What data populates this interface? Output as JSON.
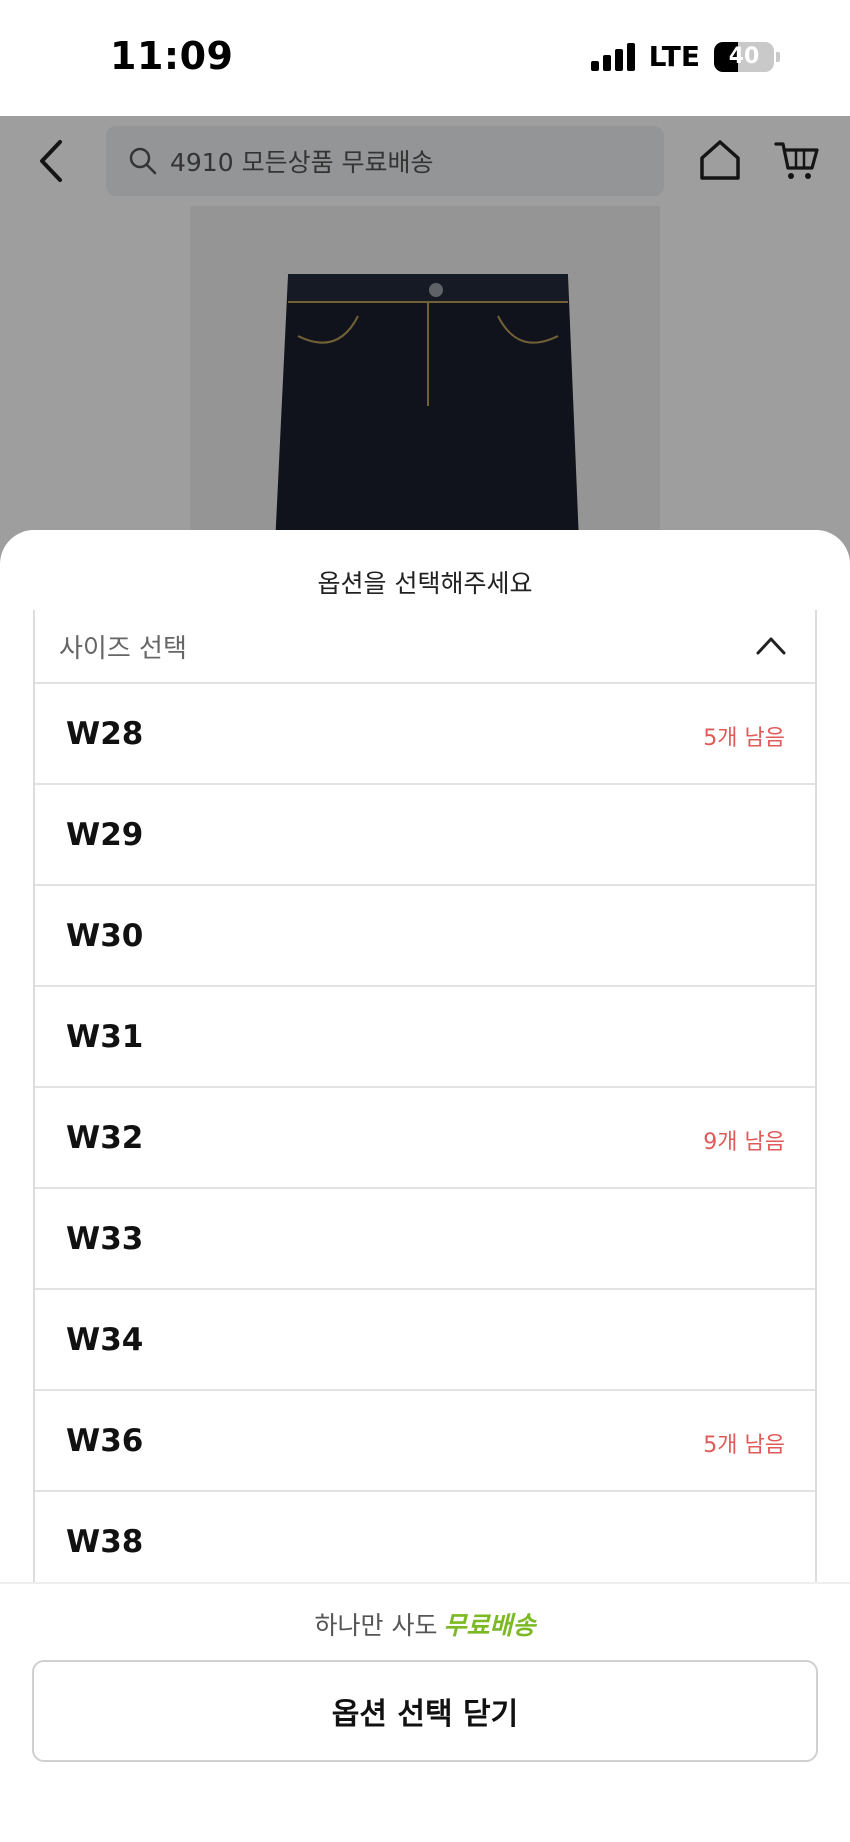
{
  "status_bar": {
    "time": "11:09",
    "network": "LTE",
    "battery": "40",
    "battery_level": 0.4
  },
  "header": {
    "search_text": "4910 모든상품 무료배송"
  },
  "sheet": {
    "title": "옵션을 선택해주세요",
    "dropdown_placeholder": "사이즈 선택",
    "options": [
      {
        "label": "W28",
        "stock": "5개 남음"
      },
      {
        "label": "W29",
        "stock": ""
      },
      {
        "label": "W30",
        "stock": ""
      },
      {
        "label": "W31",
        "stock": ""
      },
      {
        "label": "W32",
        "stock": "9개 남음"
      },
      {
        "label": "W33",
        "stock": ""
      },
      {
        "label": "W34",
        "stock": ""
      },
      {
        "label": "W36",
        "stock": "5개 남음"
      },
      {
        "label": "W38",
        "stock": ""
      }
    ],
    "promo_text": "하나만 사도",
    "promo_highlight": "무료배송",
    "close_button": "옵션 선택 닫기"
  },
  "colors": {
    "stock_text": "#e05a5a",
    "promo_highlight": "#7cb925"
  }
}
